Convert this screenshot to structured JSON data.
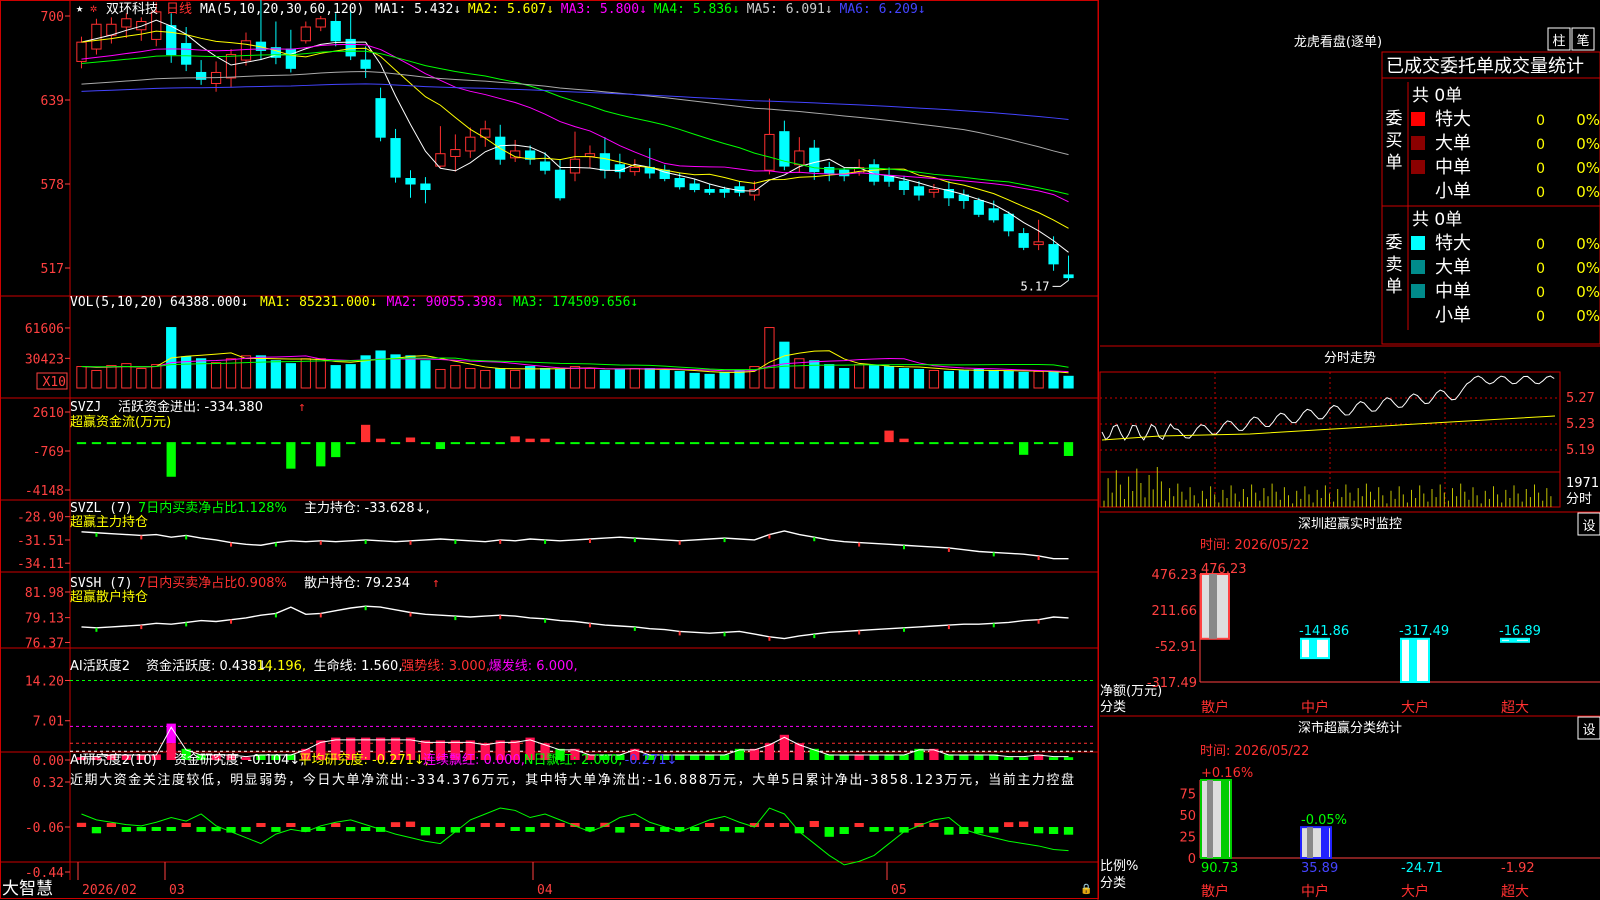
{
  "colors": {
    "up": "#ff3030",
    "down": "#00ffff",
    "frame": "#cc0000",
    "axis": "#ff4040",
    "white": "#ffffff",
    "yellow": "#ffff00",
    "magenta": "#ff00ff",
    "green": "#00ff00",
    "blue": "#4444ff",
    "gray": "#aaaaaa",
    "cyan": "#00ffff"
  },
  "header": {
    "stock_name": "双环科技",
    "period": "日线",
    "ma_label": "MA(5,10,20,30,60,120)",
    "ma_items": [
      {
        "label": "MA1: 5.432↓",
        "color": "#ffffff"
      },
      {
        "label": "MA2: 5.607↓",
        "color": "#ffff00"
      },
      {
        "label": "MA3: 5.800↓",
        "color": "#ff00ff"
      },
      {
        "label": "MA4: 5.836↓",
        "color": "#00ff00"
      },
      {
        "label": "MA5: 6.091↓",
        "color": "#cccccc"
      },
      {
        "label": "MA6: 6.209↓",
        "color": "#4444ff"
      }
    ]
  },
  "chart_data": [
    {
      "type": "candlestick",
      "name": "price",
      "y_ticks": [
        "700",
        "639",
        "578",
        "517"
      ],
      "ylim": [
        517,
        700
      ],
      "high_label": "7.00",
      "low_label": "5.17",
      "candles": [
        [
          667,
          681,
          662,
          685
        ],
        [
          676,
          694,
          672,
          698
        ],
        [
          686,
          694,
          680,
          699
        ],
        [
          692,
          698,
          684,
          702
        ],
        [
          690,
          696,
          682,
          699
        ],
        [
          683,
          703,
          678,
          710
        ],
        [
          693,
          672,
          666,
          702
        ],
        [
          680,
          665,
          660,
          692
        ],
        [
          659,
          654,
          650,
          668
        ],
        [
          651,
          659,
          645,
          667
        ],
        [
          655,
          672,
          648,
          676
        ],
        [
          668,
          682,
          664,
          688
        ],
        [
          681,
          675,
          668,
          722
        ],
        [
          677,
          670,
          665,
          696
        ],
        [
          676,
          662,
          659,
          690
        ],
        [
          682,
          692,
          680,
          696
        ],
        [
          692,
          698,
          689,
          700
        ],
        [
          696,
          682,
          678,
          702
        ],
        [
          683,
          671,
          668,
          704
        ],
        [
          668,
          662,
          655,
          678
        ],
        [
          640,
          612,
          609,
          648
        ],
        [
          611,
          583,
          579,
          618
        ],
        [
          582,
          578,
          568,
          588
        ],
        [
          578,
          574,
          564,
          583
        ],
        [
          591,
          600,
          590,
          620
        ],
        [
          598,
          603,
          587,
          614
        ],
        [
          602,
          612,
          597,
          619
        ],
        [
          612,
          618,
          605,
          624
        ],
        [
          612,
          596,
          592,
          621
        ],
        [
          597,
          602,
          594,
          610
        ],
        [
          602,
          596,
          592,
          606
        ],
        [
          594,
          588,
          585,
          601
        ],
        [
          588,
          568,
          566,
          596
        ],
        [
          586,
          596,
          580,
          616
        ],
        [
          598,
          600,
          590,
          606
        ],
        [
          600,
          588,
          582,
          612
        ],
        [
          592,
          587,
          582,
          600
        ],
        [
          587,
          590,
          584,
          596
        ],
        [
          590,
          586,
          582,
          604
        ],
        [
          588,
          582,
          580,
          592
        ],
        [
          582,
          576,
          574,
          586
        ],
        [
          578,
          574,
          572,
          582
        ],
        [
          574,
          572,
          570,
          578
        ],
        [
          574,
          572,
          568,
          576
        ],
        [
          576,
          572,
          569,
          580
        ],
        [
          570,
          574,
          566,
          580
        ],
        [
          588,
          614,
          585,
          640
        ],
        [
          616,
          591,
          588,
          624
        ],
        [
          592,
          602,
          586,
          612
        ],
        [
          604,
          587,
          581,
          610
        ],
        [
          590,
          586,
          580,
          594
        ],
        [
          588,
          584,
          580,
          590
        ],
        [
          586,
          590,
          584,
          596
        ],
        [
          592,
          580,
          577,
          596
        ],
        [
          584,
          580,
          576,
          590
        ],
        [
          580,
          574,
          570,
          584
        ],
        [
          576,
          570,
          566,
          580
        ],
        [
          572,
          574,
          568,
          578
        ],
        [
          574,
          568,
          562,
          580
        ],
        [
          570,
          566,
          560,
          574
        ],
        [
          566,
          556,
          554,
          568
        ],
        [
          560,
          552,
          550,
          566
        ],
        [
          556,
          544,
          540,
          558
        ],
        [
          542,
          532,
          530,
          546
        ],
        [
          534,
          536,
          530,
          552
        ],
        [
          534,
          520,
          515,
          540
        ],
        [
          512,
          510,
          508,
          526
        ]
      ]
    },
    {
      "type": "bar",
      "name": "VOL",
      "title": "VOL(5,10,20)",
      "title_val": "64388.000↓",
      "series_labels": [
        {
          "label": "MA1: 85231.000↓",
          "color": "#ffff00"
        },
        {
          "label": "MA2: 90055.398↓",
          "color": "#ff00ff"
        },
        {
          "label": "MA3: 174509.656↓",
          "color": "#00ff00"
        }
      ],
      "y_ticks": [
        "61606",
        "30423"
      ],
      "unit": "X10",
      "ylim": [
        0,
        80000
      ],
      "values": [
        22000,
        18000,
        23000,
        25000,
        20000,
        24000,
        62000,
        32000,
        30000,
        26000,
        30000,
        33000,
        33000,
        28000,
        25000,
        30000,
        30000,
        23000,
        24000,
        33000,
        38000,
        34000,
        33000,
        28000,
        19000,
        23000,
        20000,
        18000,
        20000,
        18000,
        22000,
        20000,
        19000,
        22000,
        20000,
        18000,
        19000,
        20000,
        20000,
        18000,
        17000,
        15000,
        14000,
        16000,
        18000,
        22000,
        62000,
        47000,
        30000,
        28000,
        24000,
        20000,
        24000,
        23000,
        22000,
        20000,
        19000,
        18000,
        17000,
        18000,
        19000,
        18000,
        17000,
        16000,
        17000,
        16000,
        12000
      ]
    },
    {
      "type": "bar",
      "name": "SVZJ",
      "title": "SVZJ",
      "title_rest": "活跃资金进出: -334.380",
      "arrow": "↑",
      "sub": "超赢资金流(万元)",
      "y_ticks": [
        "2610",
        "-769",
        "-4148"
      ],
      "ylim": [
        -4148,
        2610
      ],
      "values": [
        -80,
        -80,
        -80,
        -80,
        -80,
        -80,
        -3000,
        -80,
        -80,
        -80,
        -200,
        -80,
        -80,
        -80,
        -2300,
        -80,
        -2100,
        -1300,
        -80,
        1500,
        300,
        -80,
        400,
        -80,
        -600,
        -80,
        -80,
        -80,
        -80,
        500,
        300,
        300,
        -80,
        -80,
        -80,
        -80,
        -80,
        -80,
        -80,
        -80,
        -80,
        -80,
        -80,
        -80,
        -80,
        -80,
        -80,
        -80,
        -80,
        -80,
        -80,
        -80,
        -80,
        -80,
        1000,
        300,
        -80,
        -80,
        -80,
        -80,
        -80,
        -80,
        -80,
        -1100,
        -80,
        -80,
        -1200
      ]
    },
    {
      "type": "line",
      "name": "SVZL",
      "title": "SVZL (7)",
      "rate": "7日内买卖净占比1.128%",
      "hold": "主力持仓: -33.628↓,",
      "sub": "超赢主力持仓",
      "y_ticks": [
        "-28.90",
        "-31.51",
        "-34.11"
      ],
      "ylim": [
        -34.2,
        -28.6
      ],
      "values": [
        -30.6,
        -30.7,
        -30.8,
        -30.9,
        -31.0,
        -30.9,
        -31.2,
        -31.0,
        -31.3,
        -31.5,
        -31.8,
        -32.0,
        -32.1,
        -31.8,
        -31.6,
        -31.7,
        -31.6,
        -31.7,
        -31.6,
        -31.5,
        -31.6,
        -31.7,
        -31.6,
        -31.5,
        -31.4,
        -31.5,
        -31.6,
        -31.7,
        -31.5,
        -31.6,
        -31.4,
        -31.5,
        -31.6,
        -31.5,
        -31.4,
        -31.3,
        -31.2,
        -31.3,
        -31.4,
        -31.5,
        -31.6,
        -31.5,
        -31.4,
        -31.3,
        -31.4,
        -31.5,
        -30.9,
        -30.5,
        -30.9,
        -31.2,
        -31.5,
        -31.7,
        -31.8,
        -31.9,
        -32.0,
        -32.1,
        -32.2,
        -32.3,
        -32.4,
        -32.6,
        -32.8,
        -32.9,
        -33.0,
        -33.1,
        -33.3,
        -33.6,
        -33.6
      ]
    },
    {
      "type": "line",
      "name": "SVSH",
      "title": "SVSH (7)",
      "rate": "7日内买卖净占比0.908%",
      "hold": "散户持仓: 79.234",
      "arrow": "↑",
      "sub": "超赢散户持仓",
      "y_ticks": [
        "81.98",
        "79.13",
        "76.37"
      ],
      "ylim": [
        76.2,
        82.2
      ],
      "values": [
        78.1,
        78.0,
        78.1,
        78.2,
        78.3,
        78.5,
        78.4,
        78.6,
        78.8,
        78.7,
        78.9,
        79.1,
        79.4,
        79.6,
        80.3,
        79.5,
        79.6,
        79.9,
        80.2,
        80.4,
        80.3,
        80.0,
        79.7,
        79.5,
        79.4,
        79.3,
        79.2,
        79.3,
        79.4,
        79.3,
        79.1,
        79.0,
        78.8,
        78.7,
        78.5,
        78.3,
        78.2,
        78.1,
        77.9,
        77.8,
        77.6,
        77.5,
        77.4,
        77.5,
        77.6,
        77.3,
        77.0,
        76.8,
        77.1,
        77.3,
        77.5,
        77.6,
        77.7,
        77.8,
        77.9,
        78.0,
        78.1,
        78.2,
        78.3,
        78.4,
        78.4,
        78.5,
        78.6,
        78.8,
        78.9,
        79.2,
        79.1
      ]
    },
    {
      "type": "bar",
      "name": "AI活跃度2",
      "title": "AI活跃度2",
      "lines": [
        {
          "label": "资金活跃度: 0.438↓,",
          "color": "#ffffff"
        },
        {
          "label": "14.196,",
          "color": "#ffff00"
        },
        {
          "label": "生命线: 1.560,",
          "color": "#ffffff"
        },
        {
          "label": "强势线: 3.000,",
          "color": "#ff3030"
        },
        {
          "label": "爆发线: 6.000,",
          "color": "#ff00ff"
        }
      ],
      "y_ticks": [
        "14.20",
        "7.01",
        "0.00"
      ],
      "ylim": [
        0,
        15
      ],
      "values": [
        0.5,
        0.5,
        1,
        1,
        1,
        1,
        6.5,
        2,
        1,
        1,
        1,
        0.5,
        1,
        1,
        1,
        2,
        3.5,
        4,
        4,
        4,
        4,
        4,
        4,
        3.5,
        3.5,
        3.5,
        3.5,
        3,
        3.5,
        3.5,
        4,
        3,
        2,
        2,
        1,
        1,
        1,
        2,
        1,
        1,
        1,
        1,
        1,
        1,
        2,
        2,
        3,
        4.5,
        3,
        2,
        1,
        1,
        1,
        1,
        1,
        1,
        2,
        2,
        1,
        1,
        1,
        1,
        0.5,
        0.5,
        1,
        0.5,
        0.5
      ]
    },
    {
      "type": "bar",
      "name": "AI研究度2",
      "title": "AI研究度2(10)",
      "lines": [
        {
          "label": "资金研究度: -0.104↓,",
          "color": "#ffffff"
        },
        {
          "label": "平均研究度: -0.271↓,",
          "color": "#ffff00"
        },
        {
          "label": "连续飘红: 0.000,",
          "color": "#ff00ff"
        },
        {
          "label": "N日飘红: 2.000,",
          "color": "#00ff00"
        },
        {
          "label": "-0.271↓",
          "color": "#4444ff"
        }
      ],
      "commentary": "近期大资金关注度较低，明显弱势，今日大单净流出:-334.376万元，其中特大单净流出:-16.888万元，大单5日累计净出-3858.123万元，当前主力控盘",
      "y_ticks": [
        "0.32",
        "-0.06",
        "-0.44"
      ],
      "ylim": [
        -0.44,
        0.32
      ]
    }
  ],
  "x_axis": {
    "labels": [
      "2026/02",
      "03",
      "04",
      "05"
    ],
    "brand": "大智慧"
  },
  "side": {
    "lhb_title": "龙虎看盘(逐单)",
    "lhb_buttons": [
      "柱",
      "笔"
    ],
    "table_tabs": "已成交委托单成交量统计",
    "buy": {
      "group_label": "委买单",
      "total": "共 0单",
      "rows": [
        {
          "label": "特大",
          "count": "0",
          "pct": "0%",
          "color": "#ff0000"
        },
        {
          "label": "大单",
          "count": "0",
          "pct": "0%",
          "color": "#8b0000"
        },
        {
          "label": "中单",
          "count": "0",
          "pct": "0%",
          "color": "#8b0000"
        },
        {
          "label": "小单",
          "count": "0",
          "pct": "0%",
          "color": ""
        }
      ]
    },
    "sell": {
      "group_label": "委卖单",
      "total": "共 0单",
      "rows": [
        {
          "label": "特大",
          "count": "0",
          "pct": "0%",
          "color": "#00ffff"
        },
        {
          "label": "大单",
          "count": "0",
          "pct": "0%",
          "color": "#008b8b"
        },
        {
          "label": "中单",
          "count": "0",
          "pct": "0%",
          "color": "#008b8b"
        },
        {
          "label": "小单",
          "count": "0",
          "pct": "0%",
          "color": ""
        }
      ]
    },
    "intraday_title": "分时走势",
    "intraday_ticks": [
      "5.27",
      "5.23",
      "5.19"
    ],
    "intraday_vol": [
      "1971",
      "分时"
    ],
    "sz_title": "深圳超赢实时监控",
    "sz_settings": "设",
    "sz_date": "时间: 2026/05/22",
    "sz_ticks": [
      "476.23",
      "211.66",
      "-52.91",
      "-317.49"
    ],
    "sz_ylabel": "净额(万元)",
    "sz_xtitle": "分类",
    "sz_bars": [
      {
        "cat": "散户",
        "value": 476.23,
        "label": "476.23",
        "color": "#ff4040"
      },
      {
        "cat": "中户",
        "value": -141.86,
        "label": "-141.86",
        "color": "#00ffff"
      },
      {
        "cat": "大户",
        "value": -317.49,
        "label": "-317.49",
        "color": "#00ffff"
      },
      {
        "cat": "超大",
        "value": -16.89,
        "label": "-16.89",
        "color": "#00ffff"
      }
    ],
    "cls_title": "深市超赢分类统计",
    "cls_settings": "设",
    "cls_date": "时间: 2026/05/22",
    "cls_ticks": [
      "75",
      "50",
      "25",
      "0"
    ],
    "cls_ylabel": "比例%",
    "cls_xtitle": "分类",
    "cls_bars": [
      {
        "cat": "散户",
        "value": 90.73,
        "label": "90.73",
        "top": "+0.16%",
        "fill": "#00cc00",
        "color": "#00ff00"
      },
      {
        "cat": "中户",
        "value": 35.89,
        "label": "35.89",
        "top": "-0.05%",
        "fill": "#2222ff",
        "color": "#4444ff"
      },
      {
        "cat": "大户",
        "value": -24.71,
        "label": "-24.71",
        "top": "",
        "fill": "",
        "color": "#00ffff"
      },
      {
        "cat": "超大",
        "value": -1.92,
        "label": "-1.92",
        "top": "",
        "fill": "",
        "color": "#ff4040"
      }
    ]
  }
}
